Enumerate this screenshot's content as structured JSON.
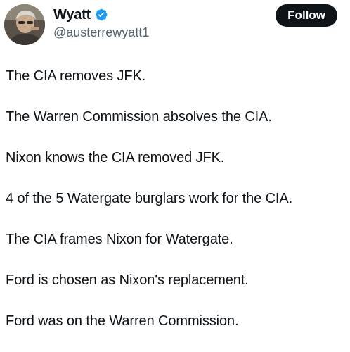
{
  "author": {
    "display_name": "Wyatt",
    "handle": "@austerrewyatt1",
    "verified": true,
    "avatar_icon": "profile-photo"
  },
  "actions": {
    "follow_label": "Follow"
  },
  "tweet": {
    "lines": [
      "The CIA removes JFK.",
      "The Warren Commission absolves the CIA.",
      "Nixon knows the CIA removed JFK.",
      "4 of the 5 Watergate burglars work for the CIA.",
      "The CIA frames Nixon for Watergate.",
      "Ford is chosen as Nixon's replacement.",
      "Ford was on the Warren Commission."
    ]
  },
  "colors": {
    "verified_badge": "#1d9bf0",
    "follow_button": "#0f1419",
    "handle_text": "#536471"
  }
}
